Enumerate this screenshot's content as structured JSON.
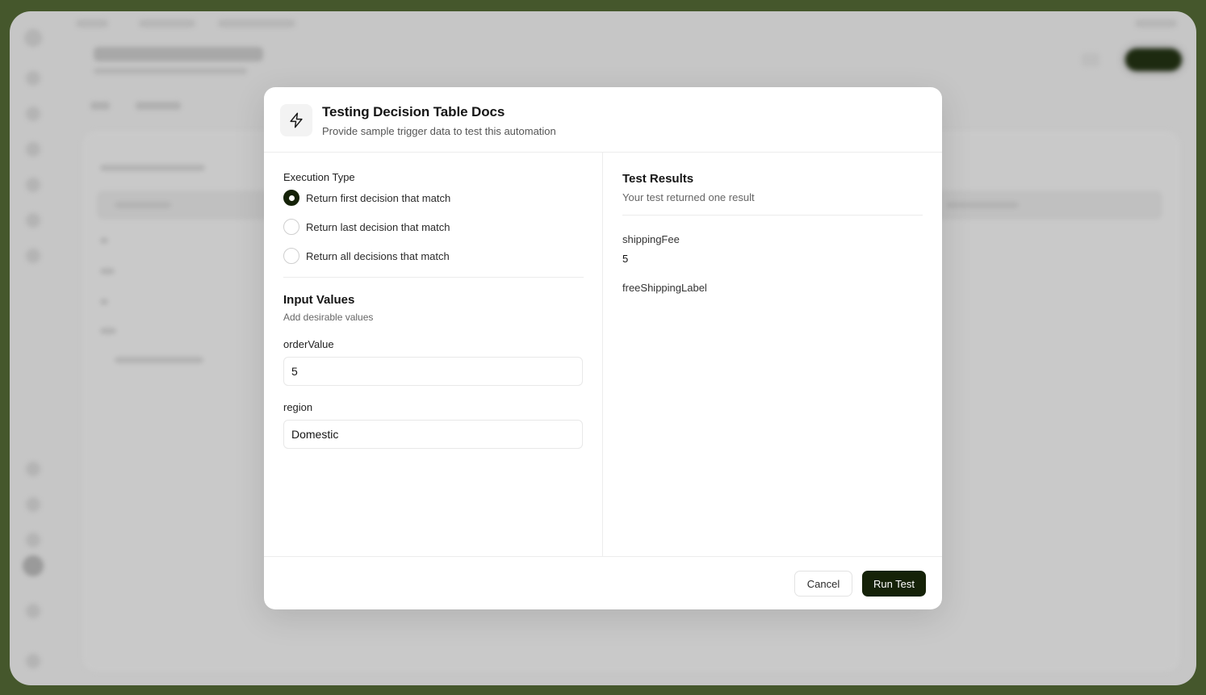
{
  "modal": {
    "icon": "lightning-bolt-icon",
    "title": "Testing Decision Table Docs",
    "subtitle": "Provide sample trigger data to test this automation"
  },
  "execution": {
    "label": "Execution Type",
    "options": [
      {
        "label": "Return first decision that match",
        "selected": true
      },
      {
        "label": "Return last decision that match",
        "selected": false
      },
      {
        "label": "Return all decisions that match",
        "selected": false
      }
    ]
  },
  "inputs": {
    "heading": "Input Values",
    "hint": "Add desirable values",
    "fields": [
      {
        "label": "orderValue",
        "value": "5"
      },
      {
        "label": "region",
        "value": "Domestic"
      }
    ]
  },
  "results": {
    "heading": "Test Results",
    "summary": "Your test returned one result",
    "items": [
      {
        "key": "shippingFee",
        "value": "5"
      },
      {
        "key": "freeShippingLabel",
        "value": ""
      }
    ]
  },
  "footer": {
    "cancel_label": "Cancel",
    "run_label": "Run Test"
  },
  "colors": {
    "primary": "#152208",
    "outer_frame": "#45572c",
    "overlay": "#c6c6c6"
  }
}
